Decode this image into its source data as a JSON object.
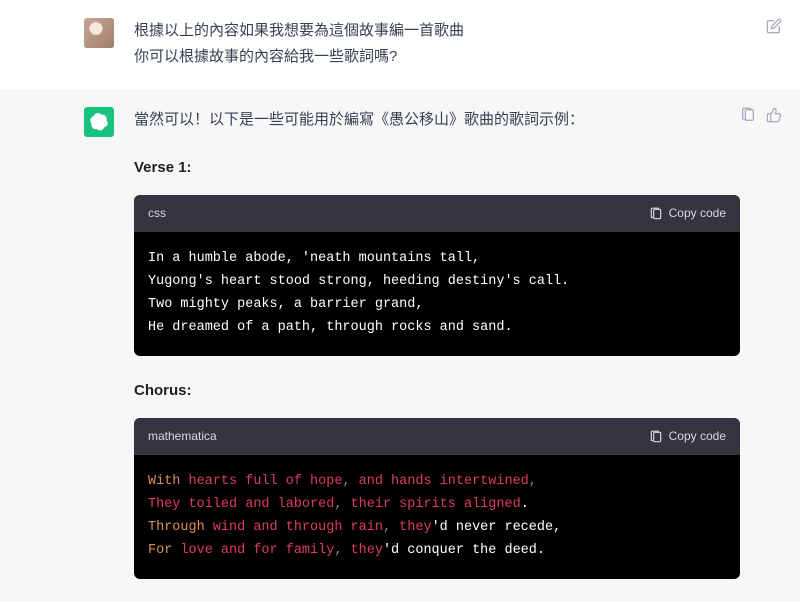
{
  "user_message": {
    "line1": "根據以上的內容如果我想要為這個故事編一首歌曲",
    "line2": "你可以根據故事的內容給我一些歌詞嗎?"
  },
  "assistant_message": {
    "intro": "當然可以！以下是一些可能用於編寫《愚公移山》歌曲的歌詞示例：",
    "sections": [
      {
        "heading": "Verse 1:",
        "code_lang": "css",
        "copy_label": "Copy code",
        "lines_plain": [
          "In a humble abode, 'neath mountains tall,",
          "Yugong's heart stood strong, heeding destiny's call.",
          "Two mighty peaks, a barrier grand,",
          "He dreamed of a path, through rocks and sand."
        ]
      },
      {
        "heading": "Chorus:",
        "code_lang": "mathematica",
        "copy_label": "Copy code",
        "lines_tokens": [
          [
            [
              "With ",
              "orange"
            ],
            [
              "hearts full of hope",
              "red"
            ],
            [
              ", ",
              "grey"
            ],
            [
              "and hands intertwined",
              "red"
            ],
            [
              ",",
              "grey"
            ]
          ],
          [
            [
              "They toiled and labored",
              "red"
            ],
            [
              ", ",
              "grey"
            ],
            [
              "their spirits aligned",
              "red"
            ],
            [
              ".",
              "white"
            ]
          ],
          [
            [
              "Through ",
              "orange"
            ],
            [
              "wind and through rain",
              "red"
            ],
            [
              ", ",
              "grey"
            ],
            [
              "they",
              "red"
            ],
            [
              "'d never recede,",
              "white"
            ]
          ],
          [
            [
              "For ",
              "orange"
            ],
            [
              "love and for family",
              "red"
            ],
            [
              ", ",
              "grey"
            ],
            [
              "they",
              "red"
            ],
            [
              "'d conquer the deed.",
              "white"
            ]
          ]
        ]
      }
    ]
  }
}
